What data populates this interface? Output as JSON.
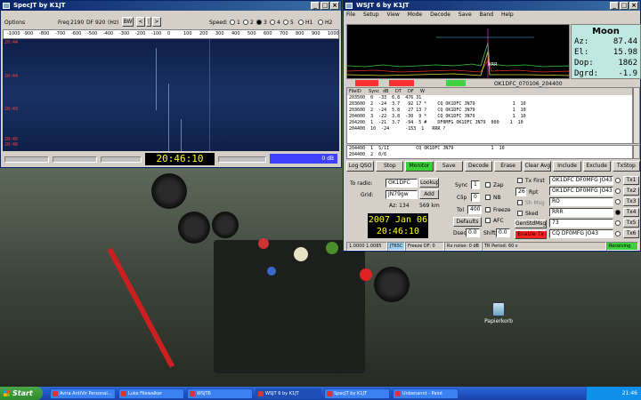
{
  "specjt": {
    "title": "SpecJT    by K1JT",
    "options_label": "Options",
    "freq_label": "Freq",
    "freq_value": "2190",
    "df_label": "DF",
    "df_value": "920",
    "hz_label": "(Hz)",
    "bw_label": "BW",
    "speed_label": "Speed:",
    "speed_options": [
      "1",
      "2",
      "3",
      "4",
      "5"
    ],
    "hz_options": [
      "H1",
      "H2"
    ],
    "scale_ticks": [
      "-1000",
      "-900",
      "-800",
      "-700",
      "-600",
      "-500",
      "-400",
      "-300",
      "-200",
      "-100",
      "0",
      "100",
      "200",
      "300",
      "400",
      "500",
      "600",
      "700",
      "800",
      "900",
      "1000"
    ],
    "waterfall_times": [
      "20:44",
      "20:43",
      "20:45",
      "20:44",
      "20:46"
    ],
    "clock": "20:46:10",
    "db_readout": "0 dB"
  },
  "wsjt": {
    "title": "WSJT 6    by K1JT",
    "menu": [
      "File",
      "Setup",
      "View",
      "Mode",
      "Decode",
      "Save",
      "Band",
      "Help"
    ],
    "plot_label": "RRR",
    "moon": {
      "title": "Moon",
      "rows": [
        {
          "k": "Az:",
          "v": "87.44"
        },
        {
          "k": "El:",
          "v": "15.98"
        },
        {
          "k": "Dop:",
          "v": "1862"
        },
        {
          "k": "Dgrd:",
          "v": "-1.9"
        }
      ]
    },
    "status_file": "OK1DFC_070106_204400",
    "decode_headers": [
      "FileID",
      "Sync",
      "dB",
      "DT",
      "DF",
      "W"
    ],
    "decode_lines": [
      "203500  0  -33  6.8  476 31",
      "203600  2  -24  3.7   92 17 *    CQ OK1DFC JN79              1  10",
      "203600  2  -24  5.8   27 13 ?    CQ OK1DFC JN79              1  10",
      "204000  3  -22  3.8  -30  9 *    CQ OK1DFC JN79              1  10",
      "204200  1  -21  3.7  -94  5 #    DF0MFG OK1DFC JN79  000    1  10",
      "204400  10  -24      -153  1   RRR ?"
    ],
    "avg_lines": [
      "204400  1  S/1I          CQ OK1DFC JN79              1  10",
      "204400  2  0/6"
    ],
    "buttons": [
      "Log QSO",
      "Stop",
      "Monitor",
      "Save",
      "Decode",
      "Erase",
      "Clear Avg",
      "Include",
      "Exclude",
      "TxStop"
    ],
    "to_radio_label": "To radio:",
    "to_radio_value": "OK1DFC",
    "lookup_label": "Lookup",
    "grid_label": "Grid:",
    "grid_value": "JN79gw",
    "add_label": "Add",
    "az_text": "Az: 134",
    "dist_text": "569 km",
    "date": "2007 Jan 06",
    "clock": "20:46:10",
    "sync_label": "Sync",
    "sync_value": "1",
    "clip_label": "Clip",
    "clip_value": "0",
    "tol_label": "Tol",
    "tol_value": "400",
    "defaults_label": "Defaults",
    "dsec_label": "Dsec",
    "dsec_value": "0.0",
    "shift_label": "Shift",
    "shift_value": "0.0",
    "zap_label": "Zap",
    "nb_label": "NB",
    "freeze_label": "Freeze",
    "afc_label": "AFC",
    "tx_first_label": "Tx First",
    "rpt_label": "Rpt",
    "rpt_value": "26",
    "sh_msg_label": "Sh Msg",
    "sked_label": "Sked",
    "gen_msgs_label": "GenStdMsgs",
    "tx_enable_label": "Enable Tx",
    "tx_messages": [
      "OK1DFC DF0MFG JO43",
      "OK1DFC DF0MFG JO43 OOO",
      "RO",
      "RRR",
      "73",
      "CQ DF0MFG JO43"
    ],
    "tx_buttons": [
      "Tx1",
      "Tx2",
      "Tx3",
      "Tx4",
      "Tx5",
      "Tx6"
    ],
    "status_bar": [
      "1.0000 1.0085",
      "JT65C",
      "Freeze DF:   0",
      "Rx noise:  0 dB",
      "TR Period: 60 s",
      "Receiving"
    ]
  },
  "desktop": {
    "recycle_label": "Papierkorb"
  },
  "taskbar": {
    "start_label": "Start",
    "tasks": [
      "Avira AntiVir Personal...",
      "Luke Filewalker",
      "WSJT6",
      "WSJT 6   by K1JT",
      "SpecJT   by K1JT",
      "Unbenannt - Paint"
    ],
    "clock": "21:46"
  }
}
